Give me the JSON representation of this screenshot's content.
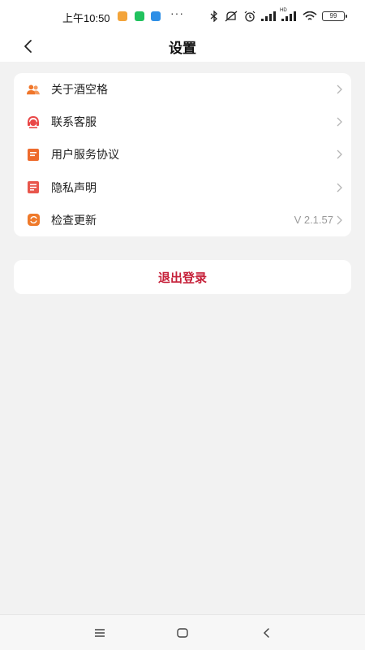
{
  "status_bar": {
    "time": "上午10:50",
    "overflow": "···",
    "network": "HD",
    "battery": "99"
  },
  "header": {
    "title": "设置"
  },
  "menu": {
    "items": [
      {
        "label": "关于酒空格",
        "icon": "about-users-icon",
        "color": "#f0762a"
      },
      {
        "label": "联系客服",
        "icon": "customer-service-icon",
        "color": "#e94747"
      },
      {
        "label": "用户服务协议",
        "icon": "agreement-icon",
        "color": "#ee6b2d"
      },
      {
        "label": "隐私声明",
        "icon": "privacy-document-icon",
        "color": "#e8564c"
      },
      {
        "label": "检查更新",
        "icon": "update-icon",
        "color": "#ef7a2b",
        "value": "V 2.1.57"
      }
    ]
  },
  "logout": {
    "label": "退出登录",
    "color": "#c6213a"
  },
  "nav_bar": {
    "icons": [
      "menu-icon",
      "home-icon",
      "back-icon"
    ]
  }
}
